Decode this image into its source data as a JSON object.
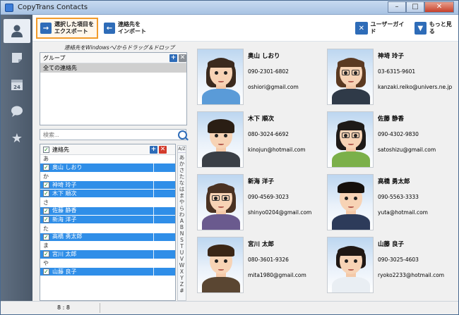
{
  "window": {
    "title": "CopyTrans Contacts"
  },
  "toolbar": {
    "export_label_1": "選択した項目を",
    "export_label_2": "エクスポート",
    "import_label_1": "連絡先を",
    "import_label_2": "インポート",
    "user_guide_label": "ユーザーガイド",
    "more_label": "もっと見る"
  },
  "hint": "連絡先をWindowsへ/からドラッグ＆ドロップ",
  "groups": {
    "header": "グループ",
    "items": [
      {
        "label": "全ての連絡先",
        "selected": true
      }
    ]
  },
  "search": {
    "placeholder": "検索..."
  },
  "contacts_list": {
    "header": "連絡先",
    "rows": [
      {
        "type": "section",
        "label": "あ"
      },
      {
        "type": "contact",
        "label": "奥山 しおり"
      },
      {
        "type": "section",
        "label": "か"
      },
      {
        "type": "contact",
        "label": "神埼 玲子"
      },
      {
        "type": "contact",
        "label": "木下 順次"
      },
      {
        "type": "section",
        "label": "さ"
      },
      {
        "type": "contact",
        "label": "佐藤 静香"
      },
      {
        "type": "contact",
        "label": "新海 洋子"
      },
      {
        "type": "section",
        "label": "た"
      },
      {
        "type": "contact",
        "label": "高橋 勇太郎"
      },
      {
        "type": "section",
        "label": "ま"
      },
      {
        "type": "contact",
        "label": "宮川 太郎"
      },
      {
        "type": "section",
        "label": "や"
      },
      {
        "type": "contact",
        "label": "山藤 良子"
      }
    ]
  },
  "az_index": {
    "header": "A/Z",
    "letters": [
      "あ",
      "か",
      "さ",
      "た",
      "な",
      "は",
      "ま",
      "や",
      "ら",
      "わ",
      "A",
      "B",
      "N",
      "S",
      "T",
      "U",
      "V",
      "W",
      "X",
      "Y",
      "Z",
      "#"
    ]
  },
  "cards": [
    {
      "name": "奥山 しおり",
      "phone": "090-2301-6802",
      "email": "oshiori@gmail.com"
    },
    {
      "name": "神埼 玲子",
      "phone": "03-6315-9601",
      "email": "kanzaki.reiko@univers.ne.jp"
    },
    {
      "name": "木下 順次",
      "phone": "080-3024-6692",
      "email": "kinojun@hotmail.com"
    },
    {
      "name": "佐藤 静香",
      "phone": "090-4302-9830",
      "email": "satoshizu@gmail.com"
    },
    {
      "name": "新海 洋子",
      "phone": "090-4569-3023",
      "email": "shinyo0204@gmail.com"
    },
    {
      "name": "高橋 勇太郎",
      "phone": "090-5563-3333",
      "email": "yuta@hotmail.com"
    },
    {
      "name": "宮川 太郎",
      "phone": "080-3601-9326",
      "email": "mita1980@gmail.com"
    },
    {
      "name": "山藤 良子",
      "phone": "090-3025-4603",
      "email": "ryoko2233@hotmail.com"
    }
  ],
  "status": {
    "count": "8 : 8"
  },
  "colors": {
    "accent": "#2f8ee8",
    "highlight": "#f29b2a",
    "sidebar": "#566579"
  }
}
